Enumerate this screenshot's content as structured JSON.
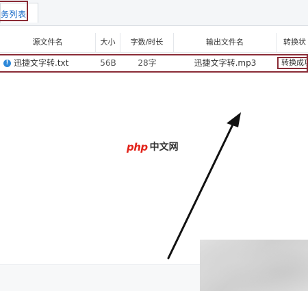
{
  "tabs": [
    {
      "label": "务列表",
      "active": true
    }
  ],
  "table": {
    "columns": [
      "源文件名",
      "大小",
      "字数/时长",
      "输出文件名",
      "转换状"
    ],
    "rows": [
      {
        "source_file": "迅捷文字转.txt",
        "size": "56B",
        "duration": "28字",
        "output_file": "迅捷文字转.mp3",
        "status": "转换成功"
      }
    ]
  },
  "watermark": {
    "logo": "php",
    "text": "中文网"
  },
  "colors": {
    "highlight_border": "#8a2b36",
    "tab_text": "#1a6cc8",
    "info_icon": "#2c88d9",
    "watermark_logo": "#e2231a"
  },
  "icons": {
    "row_status": "info-icon"
  }
}
